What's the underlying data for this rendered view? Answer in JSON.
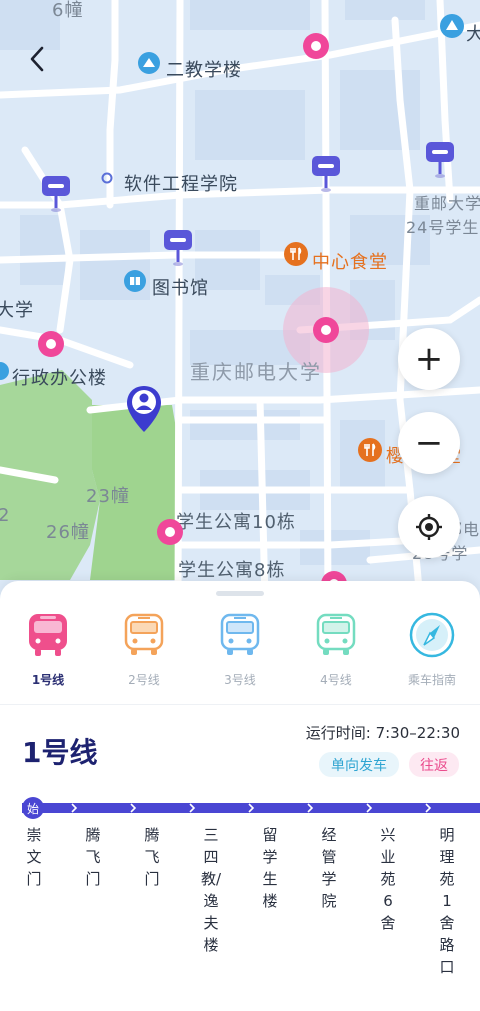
{
  "map": {
    "labels": {
      "building_6": "6幢",
      "teaching_2": "二教学楼",
      "software_college": "软件工程学院",
      "library": "图书馆",
      "cqupt_dorm24_line1": "重邮大学",
      "cqupt_dorm24_line2": "24号学生",
      "canteen_center": "中心食堂",
      "edge_xue": "大学",
      "admin_building": "行政办公楼",
      "university": "重庆邮电大学",
      "canteen_sakura": "樱花食堂",
      "building_23": "23幢",
      "building_26": "26幢",
      "edge_2": "2",
      "dorm_10": "学生公寓10栋",
      "dorm_8": "学生公寓8栋",
      "edge_right_1": "邮电",
      "edge_right_2": "28号学",
      "edge_top_right": "大"
    },
    "accent_pink": "#f0479a",
    "marker_blue": "#4b48d6"
  },
  "controls": {
    "zoom_in": "+",
    "zoom_out": "−"
  },
  "tabs": [
    {
      "label": "1号线",
      "color": "#ef4f8c",
      "active": true
    },
    {
      "label": "2号线",
      "color": "#f4a35a",
      "active": false
    },
    {
      "label": "3号线",
      "color": "#6fb8ee",
      "active": false
    },
    {
      "label": "4号线",
      "color": "#74dcc0",
      "active": false
    },
    {
      "label": "乘车指南",
      "color": "#36b8e0",
      "active": false
    }
  ],
  "line": {
    "title": "1号线",
    "runtime": "运行时间: 7:30–22:30",
    "badge_single": "单向发车",
    "badge_round": "往返",
    "start_marker": "始",
    "color": "#4a46d3",
    "stops": [
      "崇文门",
      "腾飞门",
      "腾飞门",
      "三四教/逸夫楼",
      "留学生楼",
      "经管学院",
      "兴业苑6舍",
      "明理苑1舍路口"
    ]
  }
}
